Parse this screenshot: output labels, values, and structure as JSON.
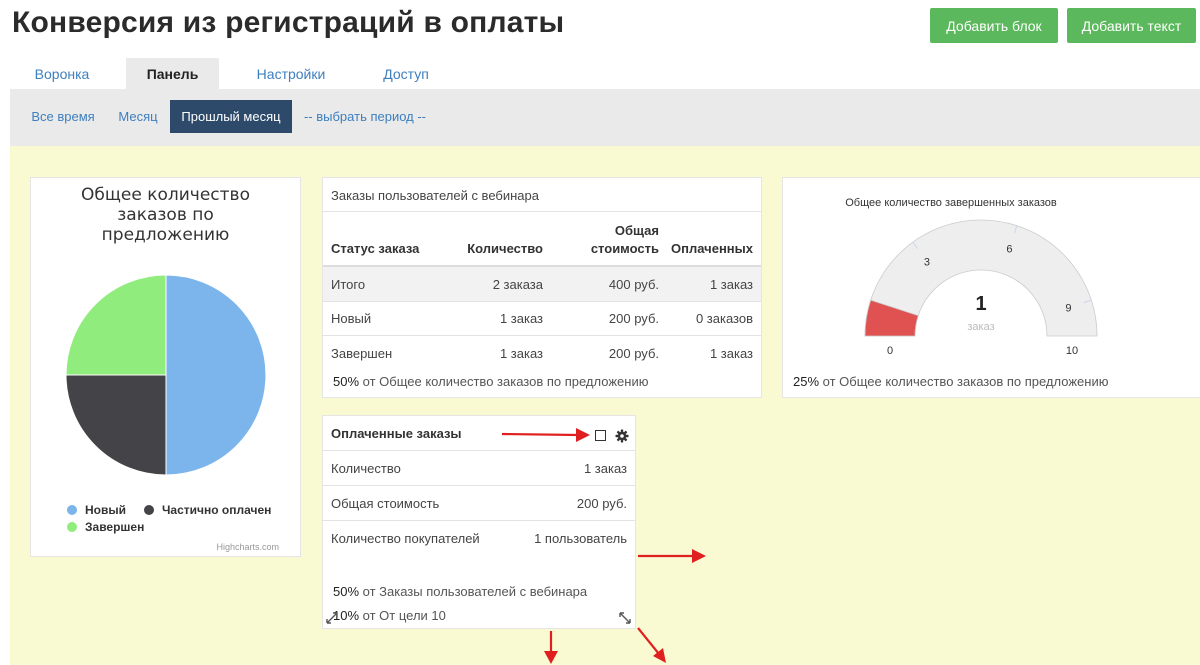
{
  "header": {
    "title": "Конверсия из регистраций в оплаты",
    "add_block": "Добавить блок",
    "add_text": "Добавить текст"
  },
  "tabs": [
    {
      "label": "Воронка"
    },
    {
      "label": "Панель"
    },
    {
      "label": "Настройки"
    },
    {
      "label": "Доступ"
    }
  ],
  "filters": {
    "all_time": "Все время",
    "month": "Месяц",
    "last_month": "Прошлый месяц",
    "choose_period": "-- выбрать период --"
  },
  "pie_panel": {
    "title_lines": [
      "Общее количество",
      "заказов по",
      "предложению"
    ],
    "legend": [
      {
        "label": "Новый",
        "color": "#7cb5ec"
      },
      {
        "label": "Частично оплачен",
        "color": "#434348"
      },
      {
        "label": "Завершен",
        "color": "#90ed7d"
      }
    ],
    "credits": "Highcharts.com"
  },
  "chart_data": {
    "type": "pie",
    "title": "Общее количество заказов по предложению",
    "slices": [
      {
        "name": "Новый",
        "value": 50,
        "color": "#7cb5ec"
      },
      {
        "name": "Частично оплачен",
        "value": 25,
        "color": "#434348"
      },
      {
        "name": "Завершен",
        "value": 25,
        "color": "#90ed7d"
      }
    ]
  },
  "orders_table": {
    "title": "Заказы пользователей с вебинара",
    "headers": {
      "status": "Статус заказа",
      "quantity": "Количество",
      "total_line1": "Общая",
      "total_line2": "стоимость",
      "paid": "Оплаченных"
    },
    "rows": [
      {
        "status": "Итого",
        "quantity": "2 заказа",
        "total": "400 руб.",
        "paid": "1 заказ"
      },
      {
        "status": "Новый",
        "quantity": "1 заказ",
        "total": "200 руб.",
        "paid": "0 заказов"
      },
      {
        "status": "Завершен",
        "quantity": "1 заказ",
        "total": "200 руб.",
        "paid": "1 заказ"
      }
    ],
    "footer_pct": "50%",
    "footer_text": "от Общее количество заказов по предложению"
  },
  "gauge": {
    "title": "Общее количество завершенных заказов",
    "value": 1,
    "value_text": "1",
    "unit": "заказ",
    "min": 0,
    "max": 10,
    "ticks": [
      "0",
      "3",
      "6",
      "9",
      "10"
    ],
    "footer_pct": "25%",
    "footer_text": "от Общее количество заказов по предложению",
    "fill_color": "#e05252"
  },
  "paid_panel": {
    "title": "Оплаченные заказы",
    "rows": [
      {
        "label": "Количество",
        "value": "1 заказ"
      },
      {
        "label": "Общая стоимость",
        "value": "200 руб."
      },
      {
        "label": "Количество покупателей",
        "value": "1 пользователь"
      }
    ],
    "footer1_pct": "50%",
    "footer1_text": "от Заказы пользователей с вебинара",
    "footer2_pct": "10%",
    "footer2_text": "от От цели 10"
  },
  "annotation_color": "#e02020"
}
